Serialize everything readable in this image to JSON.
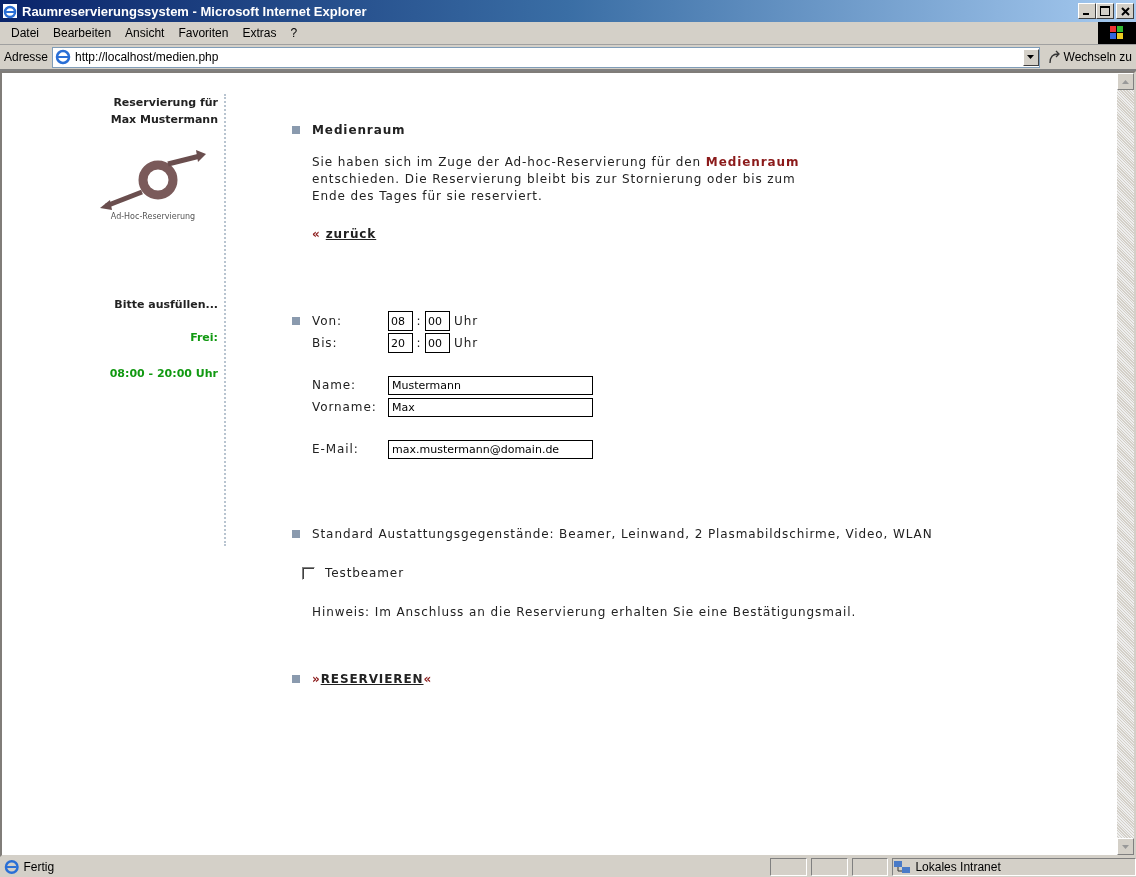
{
  "window": {
    "title": "Raumreservierungssystem - Microsoft Internet Explorer"
  },
  "menu": [
    "Datei",
    "Bearbeiten",
    "Ansicht",
    "Favoriten",
    "Extras",
    "?"
  ],
  "address_bar": {
    "label": "Adresse",
    "url": "http://localhost/medien.php",
    "go_button": "Wechseln zu"
  },
  "sidebar": {
    "heading": "Reservierung für Max Mustermann",
    "logo_caption": "Ad-Hoc-Reservierung",
    "prompt": "Bitte ausfüllen...",
    "free_label": "Frei:",
    "free_time": "08:00 - 20:00 Uhr"
  },
  "room": {
    "title": "Medienraum",
    "description": "Sie haben sich im Zuge der Ad-hoc-Reservierung für den **Medienraum** entschieden. Die Reservierung bleibt bis zur Stornierung oder bis zum Ende des Tages für sie reserviert.",
    "back_arrow": "«",
    "back_link": "zurück"
  },
  "time": [
    {
      "label": "Von:",
      "hour": "08",
      "separator": ":",
      "minute": "00",
      "unit": "Uhr"
    },
    {
      "label": "Bis:",
      "hour": "20",
      "separator": ":",
      "minute": "00",
      "unit": "Uhr"
    }
  ],
  "person": [
    {
      "label": "Name:",
      "value": "Mustermann"
    },
    {
      "label": "Vorname:",
      "value": "Max"
    }
  ],
  "email": {
    "label": "E-Mail:",
    "value": "max.mustermann@domain.de"
  },
  "equipment": {
    "text": "Standard Austattungsgegenstände: Beamer, Leinwand, 2 Plasmabildschirme, Video, WLAN",
    "options": [
      {
        "label": "Testbeamer",
        "checked": false
      }
    ],
    "note": "Hinweis: Im Anschluss an die Reservierung erhalten Sie eine Bestätigungsmail."
  },
  "submit": {
    "left": "»",
    "label": "RESERVIEREN",
    "right": "«"
  },
  "status_bar": {
    "text": "Fertig",
    "zone": "Lokales Intranet"
  }
}
